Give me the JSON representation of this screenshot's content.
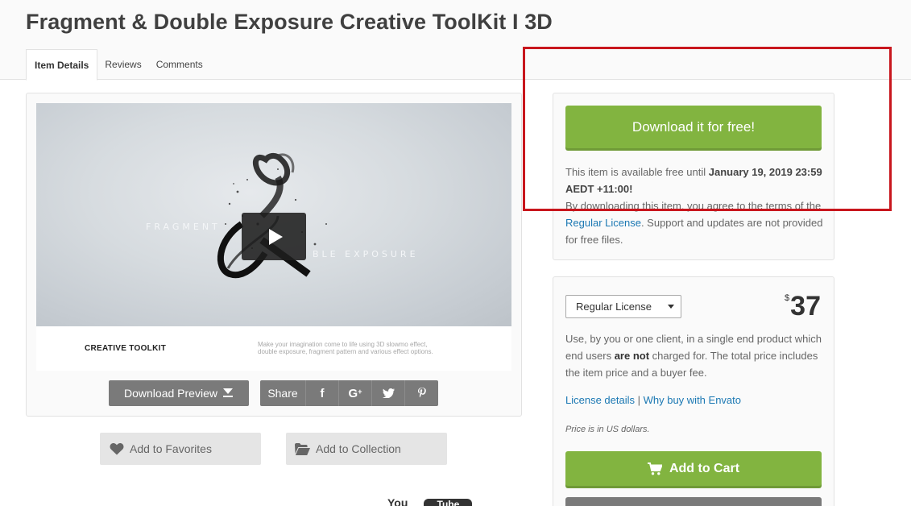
{
  "header": {
    "title": "Fragment & Double Exposure Creative ToolKit I 3D",
    "tabs": [
      {
        "label": "Item Details",
        "active": true
      },
      {
        "label": "Reviews",
        "active": false
      },
      {
        "label": "Comments",
        "active": false
      }
    ]
  },
  "preview": {
    "art_text_left": "FRAGMENT",
    "art_text_right": "BLE EXPOSURE",
    "toolkit_label": "CREATIVE TOOLKIT",
    "toolkit_desc_line1": "Make your imagination come to life using 3D slowmo effect,",
    "toolkit_desc_line2": "double exposure, fragment pattern and various effect options.",
    "download_preview_label": "Download Preview",
    "share_label": "Share",
    "share_icons": [
      {
        "name": "facebook-icon",
        "glyph": "f"
      },
      {
        "name": "google-plus-icon",
        "glyph": "G+"
      },
      {
        "name": "twitter-icon",
        "glyph": "bird"
      },
      {
        "name": "pinterest-icon",
        "glyph": "p"
      }
    ]
  },
  "actions": {
    "favorites_label": "Add to Favorites",
    "collection_label": "Add to Collection"
  },
  "youtube_hint": {
    "you": "You",
    "tube": "Tube"
  },
  "free_offer": {
    "button_label": "Download it for free!",
    "text_prefix": "This item is available free until ",
    "until_date": "January 19, 2019 23:59 AEDT +11:00!",
    "agree_prefix": "By downloading this item, you agree to the terms of the ",
    "license_link": "Regular License",
    "agree_suffix": ". Support and updates are not provided for free files."
  },
  "license": {
    "selected": "Regular License",
    "currency": "$",
    "price": "37",
    "desc_part1": "Use, by you or one client, in a single end product which end users ",
    "desc_bold": "are not",
    "desc_part2": " charged for. The total price includes the item price and a buyer fee.",
    "details_link": "License details",
    "separator": " | ",
    "why_link": "Why buy with Envato",
    "price_note": "Price is in US dollars.",
    "cart_label": "Add to Cart"
  },
  "colors": {
    "accent_green": "#82b440",
    "link_blue": "#1b78b3",
    "highlight_red": "#c8161d",
    "button_gray": "#7a7a7a"
  }
}
